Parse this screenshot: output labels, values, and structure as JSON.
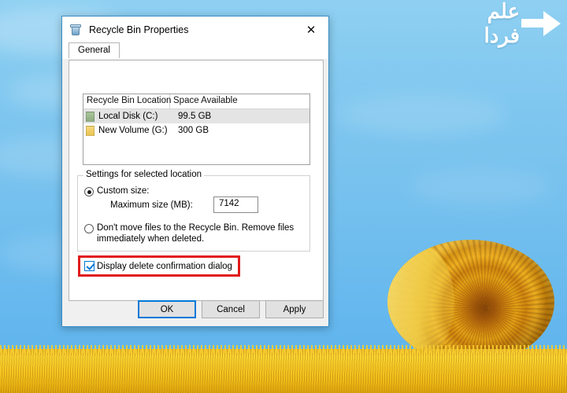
{
  "desktop": {
    "wallpaper_description": "hay-bale-on-golden-field",
    "sky_color": "#7ec6ef",
    "field_color": "#f7c722",
    "bale_color": "#d4920f"
  },
  "watermark": {
    "text": "علم فردا",
    "arrow_icon": "right-arrow-icon",
    "color": "#ffffff"
  },
  "dialog": {
    "icon": "recycle-bin-icon",
    "title": "Recycle Bin Properties",
    "close_label": "✕",
    "tabs": [
      {
        "label": "General",
        "active": true
      }
    ],
    "list": {
      "columns": [
        "Recycle Bin Location",
        "Space Available"
      ],
      "rows": [
        {
          "icon": "drive-icon-green",
          "name": "Local Disk (C:)",
          "space": "99.5 GB",
          "selected": true
        },
        {
          "icon": "drive-icon-yellow",
          "name": "New Volume (G:)",
          "space": "300 GB",
          "selected": false
        }
      ]
    },
    "settings": {
      "legend": "Settings for selected location",
      "custom_size_label": "Custom size:",
      "custom_size_selected": true,
      "maximum_size_label": "Maximum size (MB):",
      "maximum_size_value": "7142",
      "no_move_label": "Don't move files to the Recycle Bin. Remove files immediately when deleted.",
      "no_move_selected": false
    },
    "confirm": {
      "label": "Display delete confirmation dialog",
      "checked": true,
      "highlight_color": "#e01b1b"
    },
    "buttons": {
      "ok": "OK",
      "cancel": "Cancel",
      "apply": "Apply",
      "default_accent": "#0078d7"
    }
  }
}
